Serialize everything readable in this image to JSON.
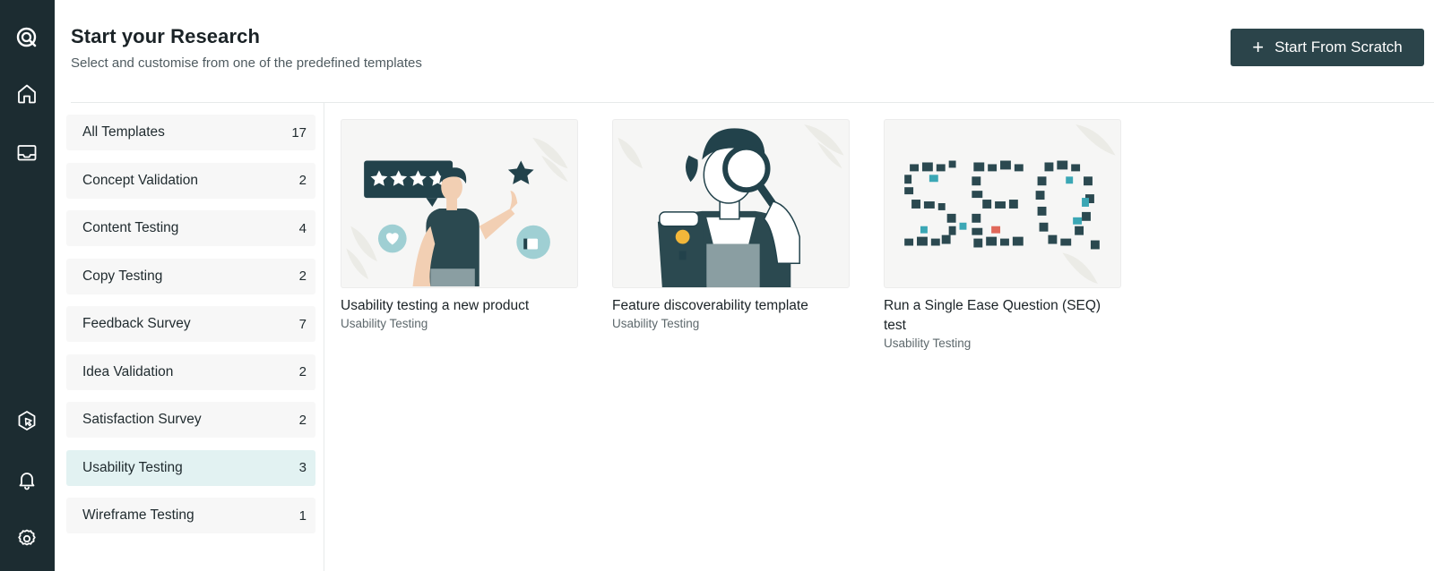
{
  "nav": {
    "items": [
      {
        "name": "logo"
      },
      {
        "name": "home"
      },
      {
        "name": "inbox"
      },
      {
        "name": "cursor"
      },
      {
        "name": "notifications"
      },
      {
        "name": "settings"
      }
    ],
    "bg_color": "#1c2c31"
  },
  "header": {
    "title": "Start your Research",
    "subtitle": "Select and customise from one of the predefined templates",
    "primary_button_label": "Start From Scratch",
    "primary_button_icon": "plus-icon",
    "primary_color": "#2b444a"
  },
  "categories": [
    {
      "label": "All Templates",
      "count": "17"
    },
    {
      "label": "Concept Validation",
      "count": "2"
    },
    {
      "label": "Content Testing",
      "count": "4"
    },
    {
      "label": "Copy Testing",
      "count": "2"
    },
    {
      "label": "Feedback Survey",
      "count": "7"
    },
    {
      "label": "Idea Validation",
      "count": "2"
    },
    {
      "label": "Satisfaction Survey",
      "count": "2"
    },
    {
      "label": "Usability Testing",
      "count": "3",
      "selected": true
    },
    {
      "label": "Wireframe Testing",
      "count": "1"
    }
  ],
  "templates": [
    {
      "title": "Usability testing a new product",
      "tag": "Usability Testing",
      "illustration": "person-rating-stars"
    },
    {
      "title": "Feature discoverability template",
      "tag": "Usability Testing",
      "illustration": "person-magnifying-glass"
    },
    {
      "title": "Run a Single Ease Question (SEQ) test",
      "tag": "Usability Testing",
      "illustration": "seq-icon-collage"
    }
  ]
}
